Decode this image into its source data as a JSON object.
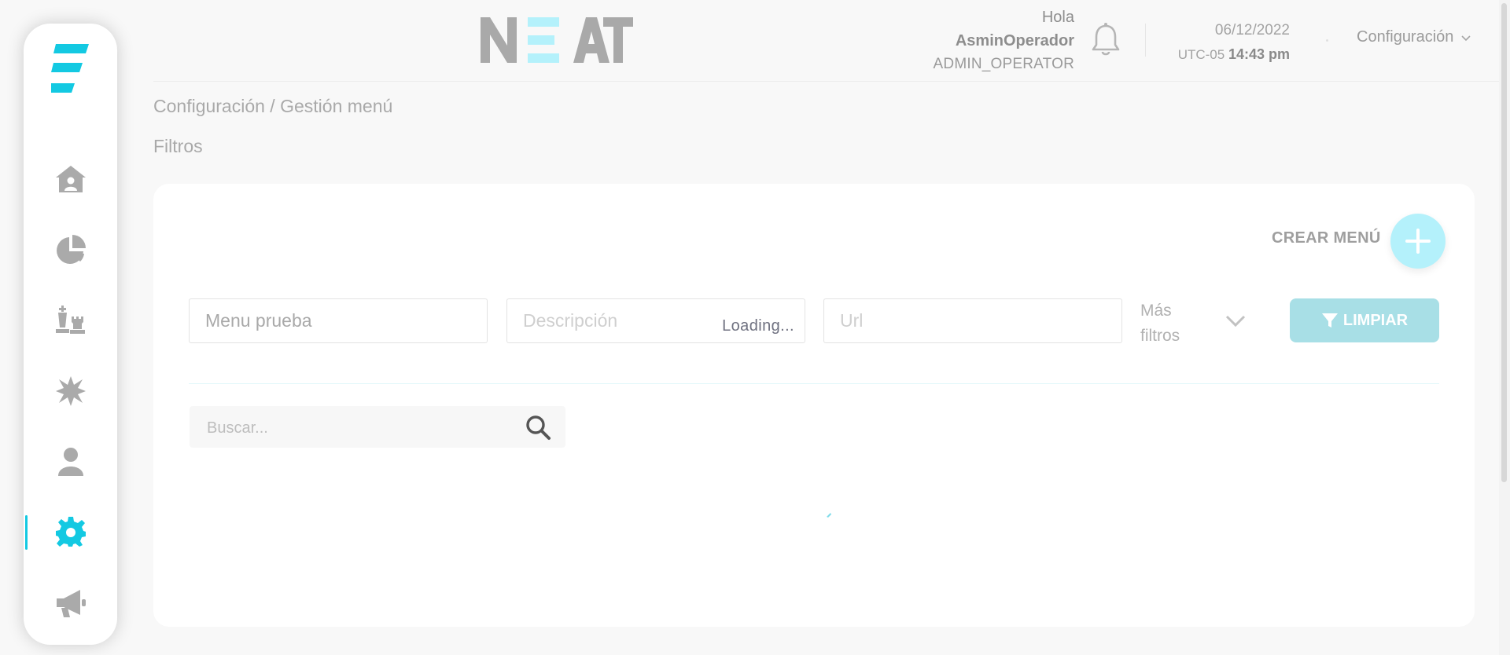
{
  "header": {
    "brand": "NEAT",
    "greeting": "Hola",
    "user_name": "AsminOperador",
    "user_role": "ADMIN_OPERATOR",
    "date": "06/12/2022",
    "timezone": "UTC-05",
    "time": "14:43 pm",
    "config_menu_label": "Configuración"
  },
  "sidebar": {
    "items": [
      {
        "name": "home",
        "icon": "home-icon",
        "active": false
      },
      {
        "name": "reports",
        "icon": "pie-chart-icon",
        "active": false
      },
      {
        "name": "strategy",
        "icon": "chess-icon",
        "active": false
      },
      {
        "name": "alerts",
        "icon": "burst-icon",
        "active": false
      },
      {
        "name": "users",
        "icon": "user-icon",
        "active": false
      },
      {
        "name": "settings",
        "icon": "gear-icon",
        "active": true
      },
      {
        "name": "campaigns",
        "icon": "megaphone-icon",
        "active": false
      }
    ]
  },
  "breadcrumb": "Configuración / Gestión menú",
  "filters_title": "Filtros",
  "create_menu_label": "CREAR MENÚ",
  "filters": {
    "name_value": "Menu prueba",
    "description_placeholder": "Descripción",
    "description_status": "Loading...",
    "url_placeholder": "Url",
    "more_filters_line1": "Más",
    "more_filters_line2": "filtros",
    "clear_label": "LIMPIAR"
  },
  "search": {
    "placeholder": "Buscar..."
  },
  "colors": {
    "accent": "#13c9e2",
    "accent_light": "#b4f1fb",
    "clear_button": "#a8dfe6"
  }
}
